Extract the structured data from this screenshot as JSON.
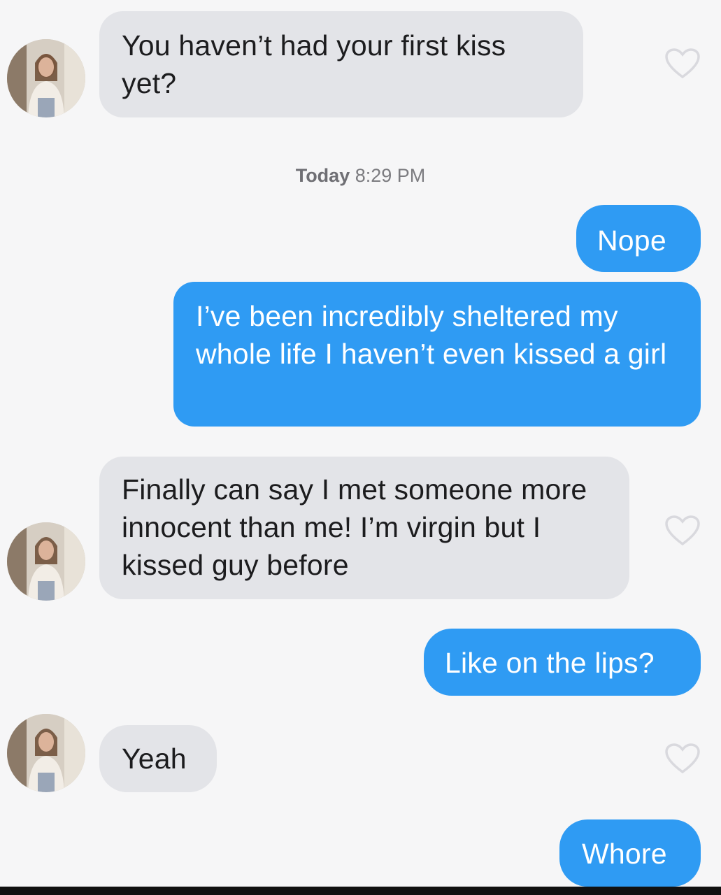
{
  "conversation": {
    "timestamp": {
      "day": "Today",
      "time": "8:29 PM"
    },
    "messages": [
      {
        "sender": "them",
        "text": "You haven’t had your first kiss yet?"
      },
      {
        "sender": "me",
        "text": "Nope"
      },
      {
        "sender": "me",
        "text": "I’ve been incredibly sheltered my whole life I haven’t even kissed a girl"
      },
      {
        "sender": "them",
        "text": "Finally can say I met someone more innocent than me! I’m virgin but I kissed guy before"
      },
      {
        "sender": "me",
        "text": "Like on the lips?"
      },
      {
        "sender": "them",
        "text": "Yeah"
      },
      {
        "sender": "me",
        "text": "Whore"
      }
    ]
  },
  "colors": {
    "incoming_bubble": "#e3e4e8",
    "outgoing_bubble": "#2f9bf3",
    "background": "#f6f6f7"
  },
  "icons": {
    "like": "heart-outline-icon",
    "avatar": "profile-photo"
  }
}
